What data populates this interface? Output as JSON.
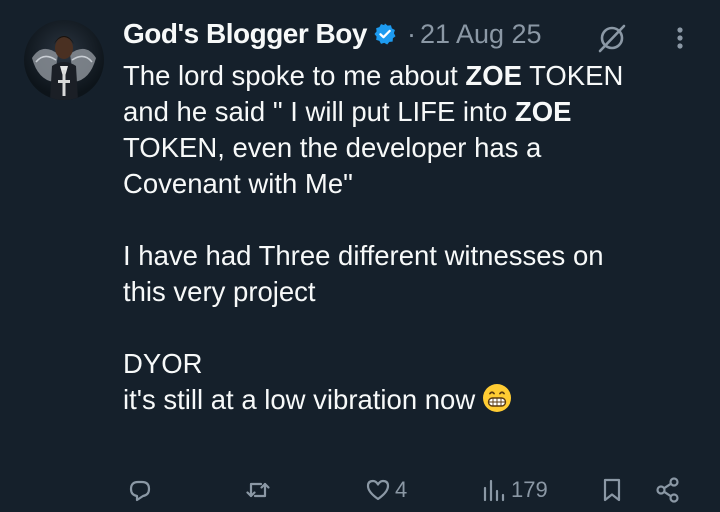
{
  "post": {
    "author_name": "God's Blogger Boy",
    "separator": "·",
    "date": "21 Aug 25",
    "line1_a": "The lord spoke to me about ",
    "line1_bold": "ZOE",
    "line1_b": " TOKEN",
    "line2_a": "and he said \" I will put LIFE into ",
    "line2_bold": "ZOE",
    "line3": "TOKEN, even the developer has a",
    "line4": "Covenant with Me\"",
    "line5": "I have had Three different witnesses on",
    "line6": "this very project",
    "line7": "DYOR",
    "line8": "it's still at a low vibration now"
  },
  "actions": {
    "likes": "4",
    "views": "179"
  },
  "colors": {
    "background": "#15202b",
    "text": "#f7f9f9",
    "muted": "#8b98a5",
    "verified": "#1d9bf0"
  },
  "icons": {
    "verified": "verified-badge-icon",
    "grok": "grok-icon",
    "more": "more-vertical-icon",
    "reply": "reply-icon",
    "repost": "repost-icon",
    "like": "heart-icon",
    "views": "views-chart-icon",
    "bookmark": "bookmark-icon",
    "share": "share-icon",
    "emoji": "grinning-face-emoji"
  }
}
